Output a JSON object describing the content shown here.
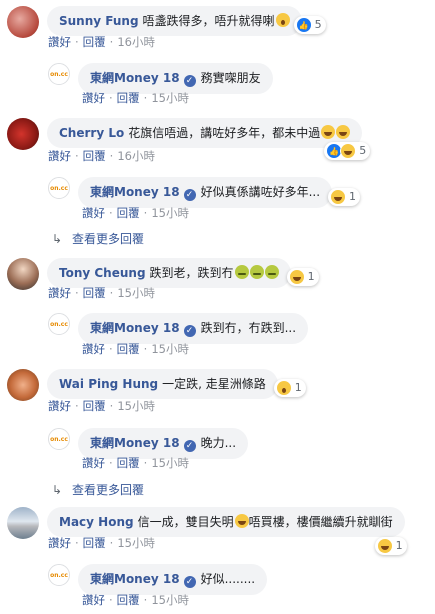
{
  "labels": {
    "like": "讚好",
    "reply": "回覆",
    "view_more": "查看更多回覆"
  },
  "page_name": "東網Money 18",
  "page_logo_text": "ON.cc",
  "threads": [
    {
      "author": "Sunny Fung",
      "text": "唔盞跌得多，唔升就得喇",
      "emoji": "fear",
      "reactions": [
        "like"
      ],
      "reaction_count": "5",
      "time": "16小時",
      "reply": {
        "text": "務實㗎朋友",
        "emoji": "",
        "reaction_count": "",
        "time": "15小時"
      },
      "view_more": false
    },
    {
      "author": "Cherry Lo",
      "text": "花旗信唔過，講咗好多年，都未中過",
      "emoji": "laugh2",
      "reactions": [
        "like",
        "rlaugh"
      ],
      "reaction_count": "5",
      "time": "16小時",
      "reply": {
        "text": "好似真係講咗好多年...",
        "emoji": "",
        "reaction_count": "1",
        "time": "15小時"
      },
      "view_more": true
    },
    {
      "author": "Tony Cheung",
      "text": "跌到老，跌到冇",
      "emoji": "sick3",
      "reactions": [],
      "reaction_count": "1",
      "time": "15小時",
      "reply": {
        "text": "跌到冇，冇跌到...",
        "emoji": "",
        "reaction_count": "",
        "time": "15小時"
      },
      "view_more": false
    },
    {
      "author": "Wai Ping Hung",
      "text": "一定跌, 走星洲條路",
      "emoji": "",
      "reactions": [],
      "reaction_count": "1",
      "time": "15小時",
      "reply": {
        "text": "晚力...",
        "emoji": "",
        "reaction_count": "",
        "time": "15小時"
      },
      "view_more": true
    },
    {
      "author": "Macy Hong",
      "text": "信一成，雙目失明",
      "text2": "唔買樓，樓價繼續升就瞓街",
      "emoji": "inline",
      "reactions": [],
      "reaction_count": "1",
      "time": "15小時",
      "reply": {
        "text": "好似........",
        "emoji": "",
        "reaction_count": "",
        "time": "15小時"
      },
      "view_more": false
    }
  ],
  "colors": {
    "link": "#385898",
    "bubble": "#f2f3f5",
    "meta": "#606770",
    "like_blue": "#1877f2"
  }
}
